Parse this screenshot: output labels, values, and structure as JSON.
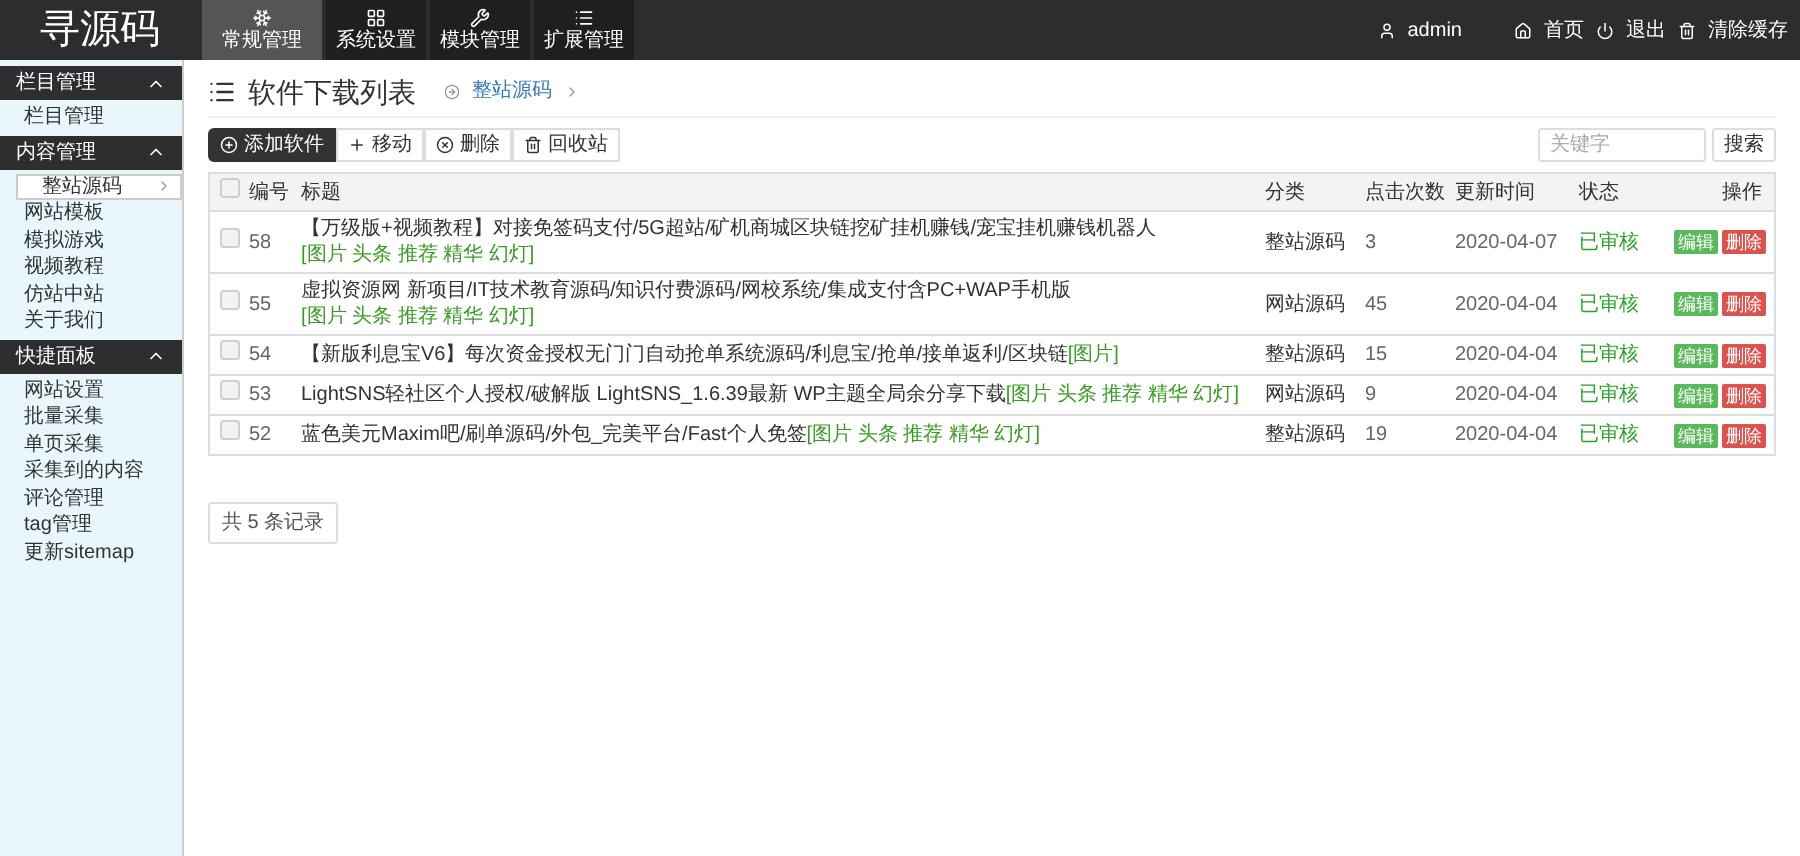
{
  "logo": "寻源码",
  "nav": [
    {
      "label": "常规管理",
      "selected": true
    },
    {
      "label": "系统设置",
      "selected": false
    },
    {
      "label": "模块管理",
      "selected": false
    },
    {
      "label": "扩展管理",
      "selected": false
    }
  ],
  "user_menu": {
    "user": "admin",
    "links": [
      "首页",
      "退出",
      "清除缓存"
    ]
  },
  "sidebar": {
    "sections": [
      {
        "title": "栏目管理",
        "expanded": true,
        "items": [
          {
            "label": "栏目管理",
            "selected": false
          }
        ]
      },
      {
        "title": "内容管理",
        "expanded": true,
        "items": [
          {
            "label": "整站源码",
            "selected": true
          },
          {
            "label": "网站模板",
            "selected": false
          },
          {
            "label": "模拟游戏",
            "selected": false
          },
          {
            "label": "视频教程",
            "selected": false
          },
          {
            "label": "仿站中站",
            "selected": false
          },
          {
            "label": "关于我们",
            "selected": false
          }
        ]
      },
      {
        "title": "快捷面板",
        "expanded": true,
        "items": [
          {
            "label": "网站设置",
            "selected": false
          },
          {
            "label": "批量采集",
            "selected": false
          },
          {
            "label": "单页采集",
            "selected": false
          },
          {
            "label": "采集到的内容",
            "selected": false
          },
          {
            "label": "评论管理",
            "selected": false
          },
          {
            "label": "tag管理",
            "selected": false
          },
          {
            "label": "更新sitemap",
            "selected": false
          }
        ]
      }
    ]
  },
  "page": {
    "title": "软件下载列表",
    "breadcrumb": "整站源码"
  },
  "toolbar": [
    {
      "label": "添加软件",
      "kind": "primary"
    },
    {
      "label": "移动",
      "kind": "plus"
    },
    {
      "label": "删除",
      "kind": "remove"
    },
    {
      "label": "回收站",
      "kind": "trash"
    }
  ],
  "search": {
    "placeholder": "关键字",
    "button": "搜索"
  },
  "table": {
    "select_all_checked": false,
    "columns": [
      "编号",
      "标题",
      "分类",
      "点击次数",
      "更新时间",
      "状态",
      "操作"
    ],
    "rows": [
      {
        "checked": false,
        "id": "58",
        "title": "【万级版+视频教程】对接免签码支付/5G超站/矿机商城区块链挖矿挂机赚钱/宠宝挂机赚钱机器人",
        "tags": "[图片 头条 推荐 精华 幻灯]",
        "category": "整站源码",
        "clicks": "3",
        "updated": "2020-04-07",
        "status": "已审核",
        "actions": [
          "编辑",
          "删除"
        ]
      },
      {
        "checked": false,
        "id": "55",
        "title": "虚拟资源网 新项目/IT技术教育源码/知识付费源码/网校系统/集成支付含PC+WAP手机版",
        "tags": "[图片 头条 推荐 精华 幻灯]",
        "category": "网站源码",
        "clicks": "45",
        "updated": "2020-04-04",
        "status": "已审核",
        "actions": [
          "编辑",
          "删除"
        ]
      },
      {
        "checked": false,
        "id": "54",
        "title": "【新版利息宝V6】每次资金授权无门门自动抢单系统源码/利息宝/抢单/接单返利/区块链",
        "tags": "[图片]",
        "category": "整站源码",
        "clicks": "15",
        "updated": "2020-04-04",
        "status": "已审核",
        "actions": [
          "编辑",
          "删除"
        ]
      },
      {
        "checked": false,
        "id": "53",
        "title": "LightSNS轻社区个人授权/破解版 LightSNS_1.6.39最新 WP主题全局余分享下载",
        "tags": "[图片 头条 推荐 精华 幻灯]",
        "category": "网站源码",
        "clicks": "9",
        "updated": "2020-04-04",
        "status": "已审核",
        "actions": [
          "编辑",
          "删除"
        ]
      },
      {
        "checked": false,
        "id": "52",
        "title": "蓝色美元Maxim吧/刷单源码/外包_完美平台/Fast个人免签",
        "tags": "[图片 头条 推荐 精华 幻灯]",
        "category": "整站源码",
        "clicks": "19",
        "updated": "2020-04-04",
        "status": "已审核",
        "actions": [
          "编辑",
          "删除"
        ]
      }
    ]
  },
  "pagination": "共 5 条记录"
}
